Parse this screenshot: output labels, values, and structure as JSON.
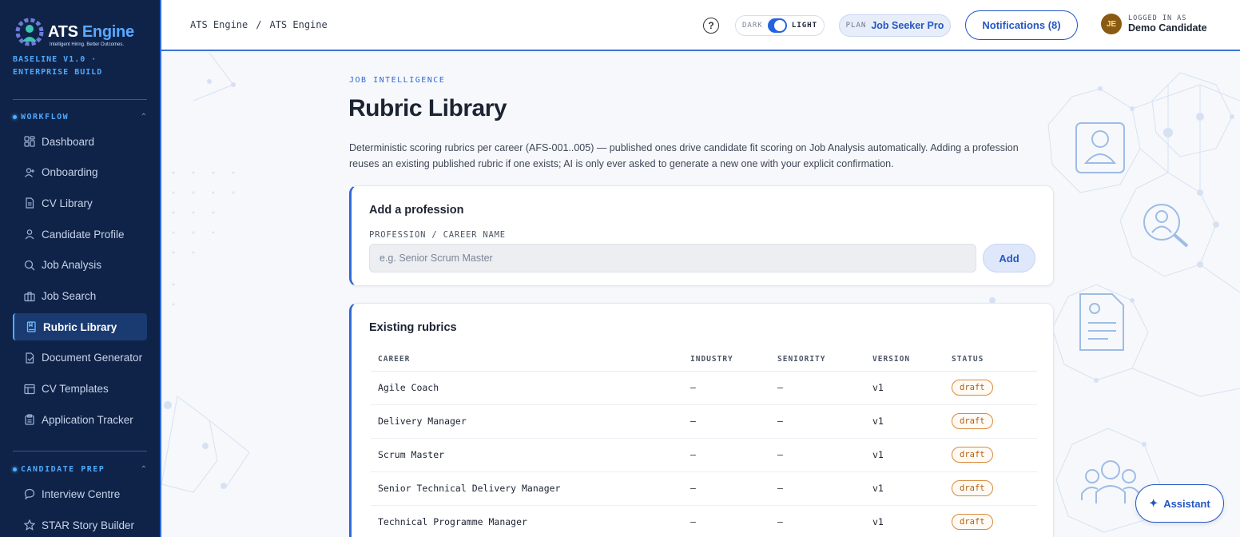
{
  "brand": {
    "name_main": "ATS",
    "name_accent": "Engine",
    "tagline": "Intelligent Hiring. Better Outcomes.",
    "build": "BASELINE V1.0 · ENTERPRISE BUILD"
  },
  "sidebar": {
    "workflow_label": "WORKFLOW",
    "workflow_items": [
      {
        "label": "Dashboard",
        "icon": "dashboard-icon"
      },
      {
        "label": "Onboarding",
        "icon": "user-plus-icon"
      },
      {
        "label": "CV Library",
        "icon": "file-icon"
      },
      {
        "label": "Candidate Profile",
        "icon": "user-icon"
      },
      {
        "label": "Job Analysis",
        "icon": "search-icon"
      },
      {
        "label": "Job Search",
        "icon": "briefcase-icon"
      },
      {
        "label": "Rubric Library",
        "icon": "book-icon",
        "active": true
      },
      {
        "label": "Document Generator",
        "icon": "document-icon"
      },
      {
        "label": "CV Templates",
        "icon": "template-icon"
      },
      {
        "label": "Application Tracker",
        "icon": "clipboard-icon"
      }
    ],
    "prep_label": "CANDIDATE PREP",
    "prep_items": [
      {
        "label": "Interview Centre",
        "icon": "chat-icon"
      },
      {
        "label": "STAR Story Builder",
        "icon": "star-icon"
      }
    ]
  },
  "header": {
    "breadcrumb": [
      "ATS Engine",
      "/",
      "ATS Engine"
    ],
    "theme_dark": "DARK",
    "theme_light": "LIGHT",
    "plan_key": "PLAN",
    "plan_value": "Job Seeker Pro",
    "notifications": "Notifications (8)",
    "user_initials": "JE",
    "user_key": "LOGGED IN AS",
    "user_name": "Demo Candidate"
  },
  "main": {
    "eyebrow": "JOB INTELLIGENCE",
    "title": "Rubric Library",
    "description": "Deterministic scoring rubrics per career (AFS-001..005) — published ones drive candidate fit scoring on Job Analysis automatically. Adding a profession reuses an existing published rubric if one exists; AI is only ever asked to generate a new one with your explicit confirmation.",
    "add_card": {
      "title": "Add a profession",
      "field_label": "PROFESSION / CAREER NAME",
      "placeholder": "e.g. Senior Scrum Master",
      "value": "",
      "button": "Add"
    },
    "rubrics_card": {
      "title": "Existing rubrics",
      "columns": [
        "CAREER",
        "INDUSTRY",
        "SENIORITY",
        "VERSION",
        "STATUS"
      ],
      "rows": [
        {
          "career": "Agile Coach",
          "industry": "—",
          "seniority": "—",
          "version": "v1",
          "status": "draft"
        },
        {
          "career": "Delivery Manager",
          "industry": "—",
          "seniority": "—",
          "version": "v1",
          "status": "draft"
        },
        {
          "career": "Scrum Master",
          "industry": "—",
          "seniority": "—",
          "version": "v1",
          "status": "draft"
        },
        {
          "career": "Senior Technical Delivery Manager",
          "industry": "—",
          "seniority": "—",
          "version": "v1",
          "status": "draft"
        },
        {
          "career": "Technical Programme Manager",
          "industry": "—",
          "seniority": "—",
          "version": "v1",
          "status": "draft"
        }
      ]
    }
  },
  "assistant": {
    "label": "Assistant",
    "icon": "sparkle-icon"
  },
  "colors": {
    "sidebar_bg": "#0f2348",
    "accent": "#2456c2",
    "draft_badge": "#d98a3a"
  }
}
